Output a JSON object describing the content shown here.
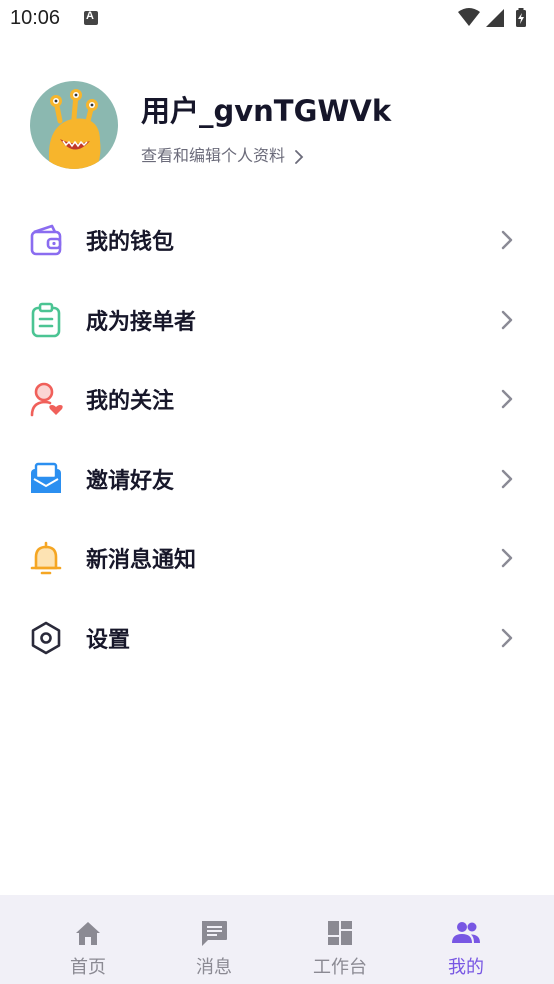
{
  "status": {
    "time": "10:06"
  },
  "profile": {
    "username": "用户_gvnTGWVk",
    "link_text": "查看和编辑个人资料"
  },
  "menu": [
    {
      "label": "我的钱包",
      "icon": "wallet-icon",
      "color": "#8a6cf0"
    },
    {
      "label": "成为接单者",
      "icon": "clipboard-icon",
      "color": "#4bc493"
    },
    {
      "label": "我的关注",
      "icon": "user-heart-icon",
      "color": "#f0605a"
    },
    {
      "label": "邀请好友",
      "icon": "mail-invite-icon",
      "color": "#2b8ff0"
    },
    {
      "label": "新消息通知",
      "icon": "bell-icon",
      "color": "#f5a623"
    },
    {
      "label": "设置",
      "icon": "settings-hex-icon",
      "color": "#2a2a3a"
    }
  ],
  "tabs": [
    {
      "label": "首页",
      "icon": "home-icon",
      "active": false
    },
    {
      "label": "消息",
      "icon": "message-icon",
      "active": false
    },
    {
      "label": "工作台",
      "icon": "dashboard-icon",
      "active": false
    },
    {
      "label": "我的",
      "icon": "people-icon",
      "active": true
    }
  ],
  "colors": {
    "accent": "#7857e3",
    "tabbar_bg": "#f1f0f7",
    "inactive_tab": "#8b8a93"
  }
}
